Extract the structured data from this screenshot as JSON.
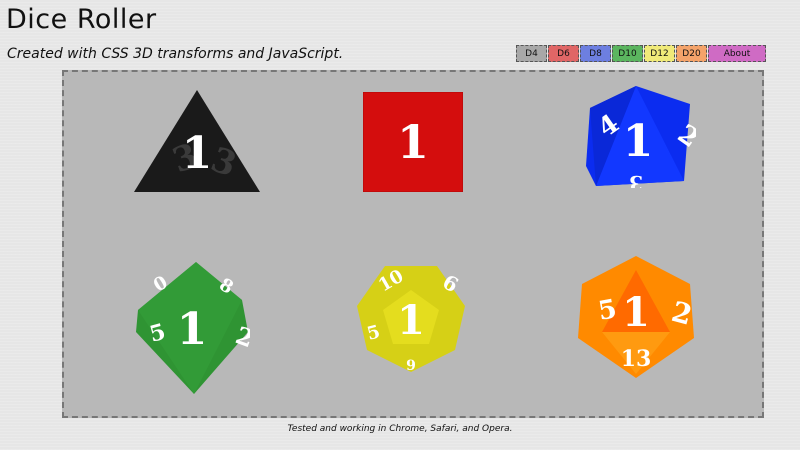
{
  "header": {
    "title": "Dice Roller",
    "subtitle": "Created with CSS 3D transforms and JavaScript."
  },
  "nav": [
    {
      "label": "D4",
      "color": "#a8a8a8"
    },
    {
      "label": "D6",
      "color": "#e06666"
    },
    {
      "label": "D8",
      "color": "#6d7fe0"
    },
    {
      "label": "D10",
      "color": "#5bb55f"
    },
    {
      "label": "D12",
      "color": "#f0ea79"
    },
    {
      "label": "D20",
      "color": "#f4a36a"
    },
    {
      "label": "About",
      "color": "#cf6bc4"
    }
  ],
  "dice": [
    {
      "name": "d4",
      "value": "1",
      "color": "#1a1a1a"
    },
    {
      "name": "d6",
      "value": "1",
      "color": "#d40d0d"
    },
    {
      "name": "d8",
      "value": "1",
      "color": "#0b2cf0"
    },
    {
      "name": "d10",
      "value": "1",
      "color": "#2f9433"
    },
    {
      "name": "d12",
      "value": "1",
      "color": "#d6d016"
    },
    {
      "name": "d20",
      "value": "1",
      "secondary_value": "13",
      "color": "#ff8a00"
    }
  ],
  "footer": {
    "text": "Tested and working in Chrome, Safari, and Opera."
  }
}
